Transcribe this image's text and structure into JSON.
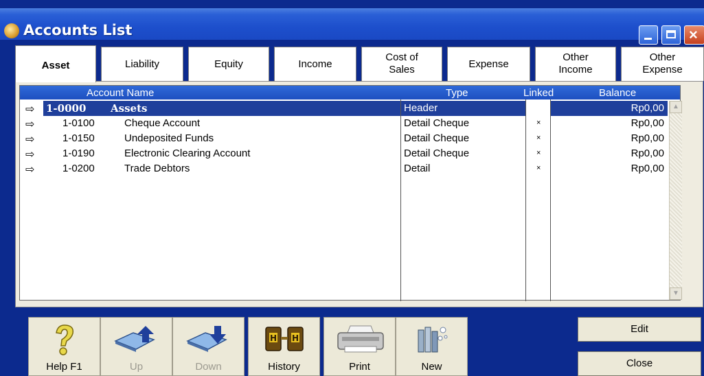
{
  "window": {
    "title": "Accounts List"
  },
  "tabs": [
    {
      "label": "Asset",
      "active": true
    },
    {
      "label": "Liability"
    },
    {
      "label": "Equity"
    },
    {
      "label": "Income"
    },
    {
      "label_line1": "Cost of",
      "label_line2": "Sales"
    },
    {
      "label": "Expense"
    },
    {
      "label_line1": "Other",
      "label_line2": "Income"
    },
    {
      "label_line1": "Other",
      "label_line2": "Expense"
    }
  ],
  "list": {
    "columns": {
      "name": "Account Name",
      "type": "Type",
      "linked": "Linked",
      "balance": "Balance"
    },
    "rows": [
      {
        "code": "1-0000",
        "name": "Assets",
        "type": "Header",
        "linked": "",
        "balance": "Rp0,00"
      },
      {
        "code": "1-0100",
        "name": "Cheque Account",
        "type": "Detail Cheque",
        "linked": "×",
        "balance": "Rp0,00"
      },
      {
        "code": "1-0150",
        "name": "Undeposited Funds",
        "type": "Detail Cheque",
        "linked": "×",
        "balance": "Rp0,00"
      },
      {
        "code": "1-0190",
        "name": "Electronic Clearing Account",
        "type": "Detail Cheque",
        "linked": "×",
        "balance": "Rp0,00"
      },
      {
        "code": "1-0200",
        "name": "Trade Debtors",
        "type": "Detail",
        "linked": "×",
        "balance": "Rp0,00"
      }
    ],
    "arrow": "⇨"
  },
  "toolbar": {
    "help": "Help F1",
    "up": "Up",
    "down": "Down",
    "history": "History",
    "print": "Print",
    "new": "New",
    "edit": "Edit",
    "close": "Close"
  }
}
